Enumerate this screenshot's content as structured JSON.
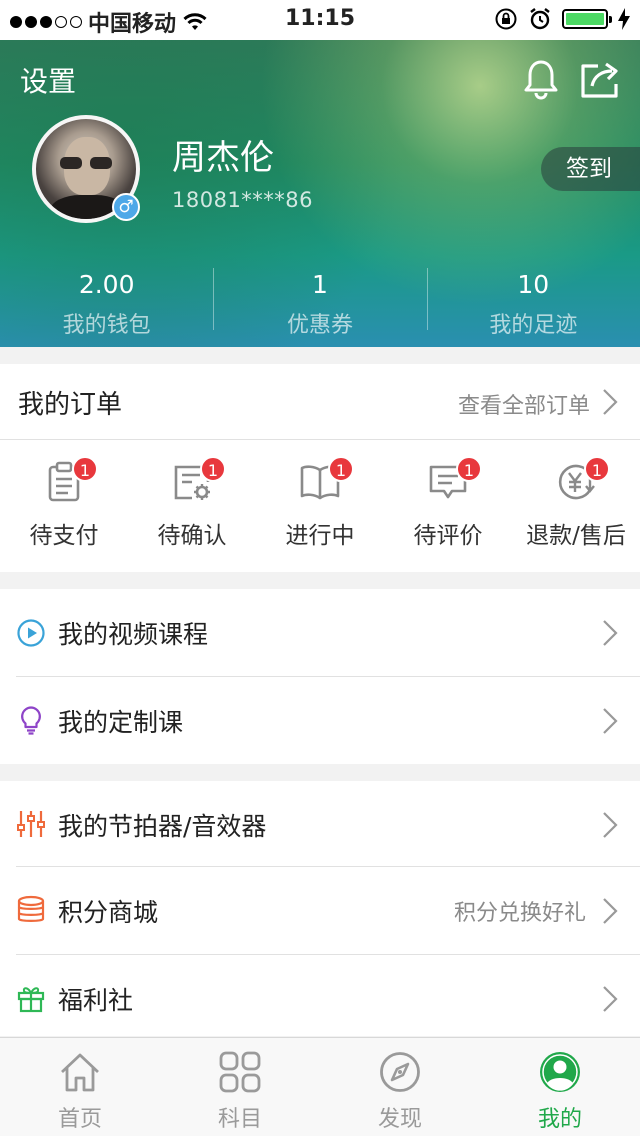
{
  "status_bar": {
    "carrier": "中国移动",
    "time": "11:15",
    "icons": [
      "signal-dots-icon",
      "wifi-icon",
      "rotation-lock-icon",
      "alarm-icon",
      "battery-icon",
      "charging-bolt-icon"
    ]
  },
  "header": {
    "settings_label": "设置",
    "username": "周杰伦",
    "phone": "18081****86",
    "gender_symbol": "♂",
    "checkin_label": "签到",
    "stats": [
      {
        "value": "2.00",
        "label": "我的钱包"
      },
      {
        "value": "1",
        "label": "优惠券"
      },
      {
        "value": "10",
        "label": "我的足迹"
      }
    ]
  },
  "orders": {
    "title": "我的订单",
    "view_all": "查看全部订单",
    "items": [
      {
        "label": "待支付",
        "badge": "1",
        "icon": "clipboard-icon"
      },
      {
        "label": "待确认",
        "badge": "1",
        "icon": "settings-document-icon"
      },
      {
        "label": "进行中",
        "badge": "1",
        "icon": "book-icon"
      },
      {
        "label": "待评价",
        "badge": "1",
        "icon": "comment-icon"
      },
      {
        "label": "退款/售后",
        "badge": "1",
        "icon": "yen-refund-icon"
      }
    ]
  },
  "menu": {
    "video_courses": "我的视频课程",
    "custom_courses": "我的定制课",
    "metronome": "我的节拍器/音效器",
    "points_mall": "积分商城",
    "points_mall_extra": "积分兑换好礼",
    "welfare": "福利社"
  },
  "tabbar": {
    "tabs": [
      {
        "label": "首页",
        "icon": "home-icon"
      },
      {
        "label": "科目",
        "icon": "grid-icon"
      },
      {
        "label": "发现",
        "icon": "compass-icon"
      },
      {
        "label": "我的",
        "icon": "profile-icon"
      }
    ],
    "active_index": 3,
    "active_color": "#20a84a"
  },
  "colors": {
    "badge": "#e8383d",
    "video_icon": "#3aa3d8",
    "custom_icon": "#8e44c8",
    "metronome_icon": "#ef6a3c",
    "points_icon": "#ef6a3c",
    "welfare_icon": "#2fb856"
  }
}
